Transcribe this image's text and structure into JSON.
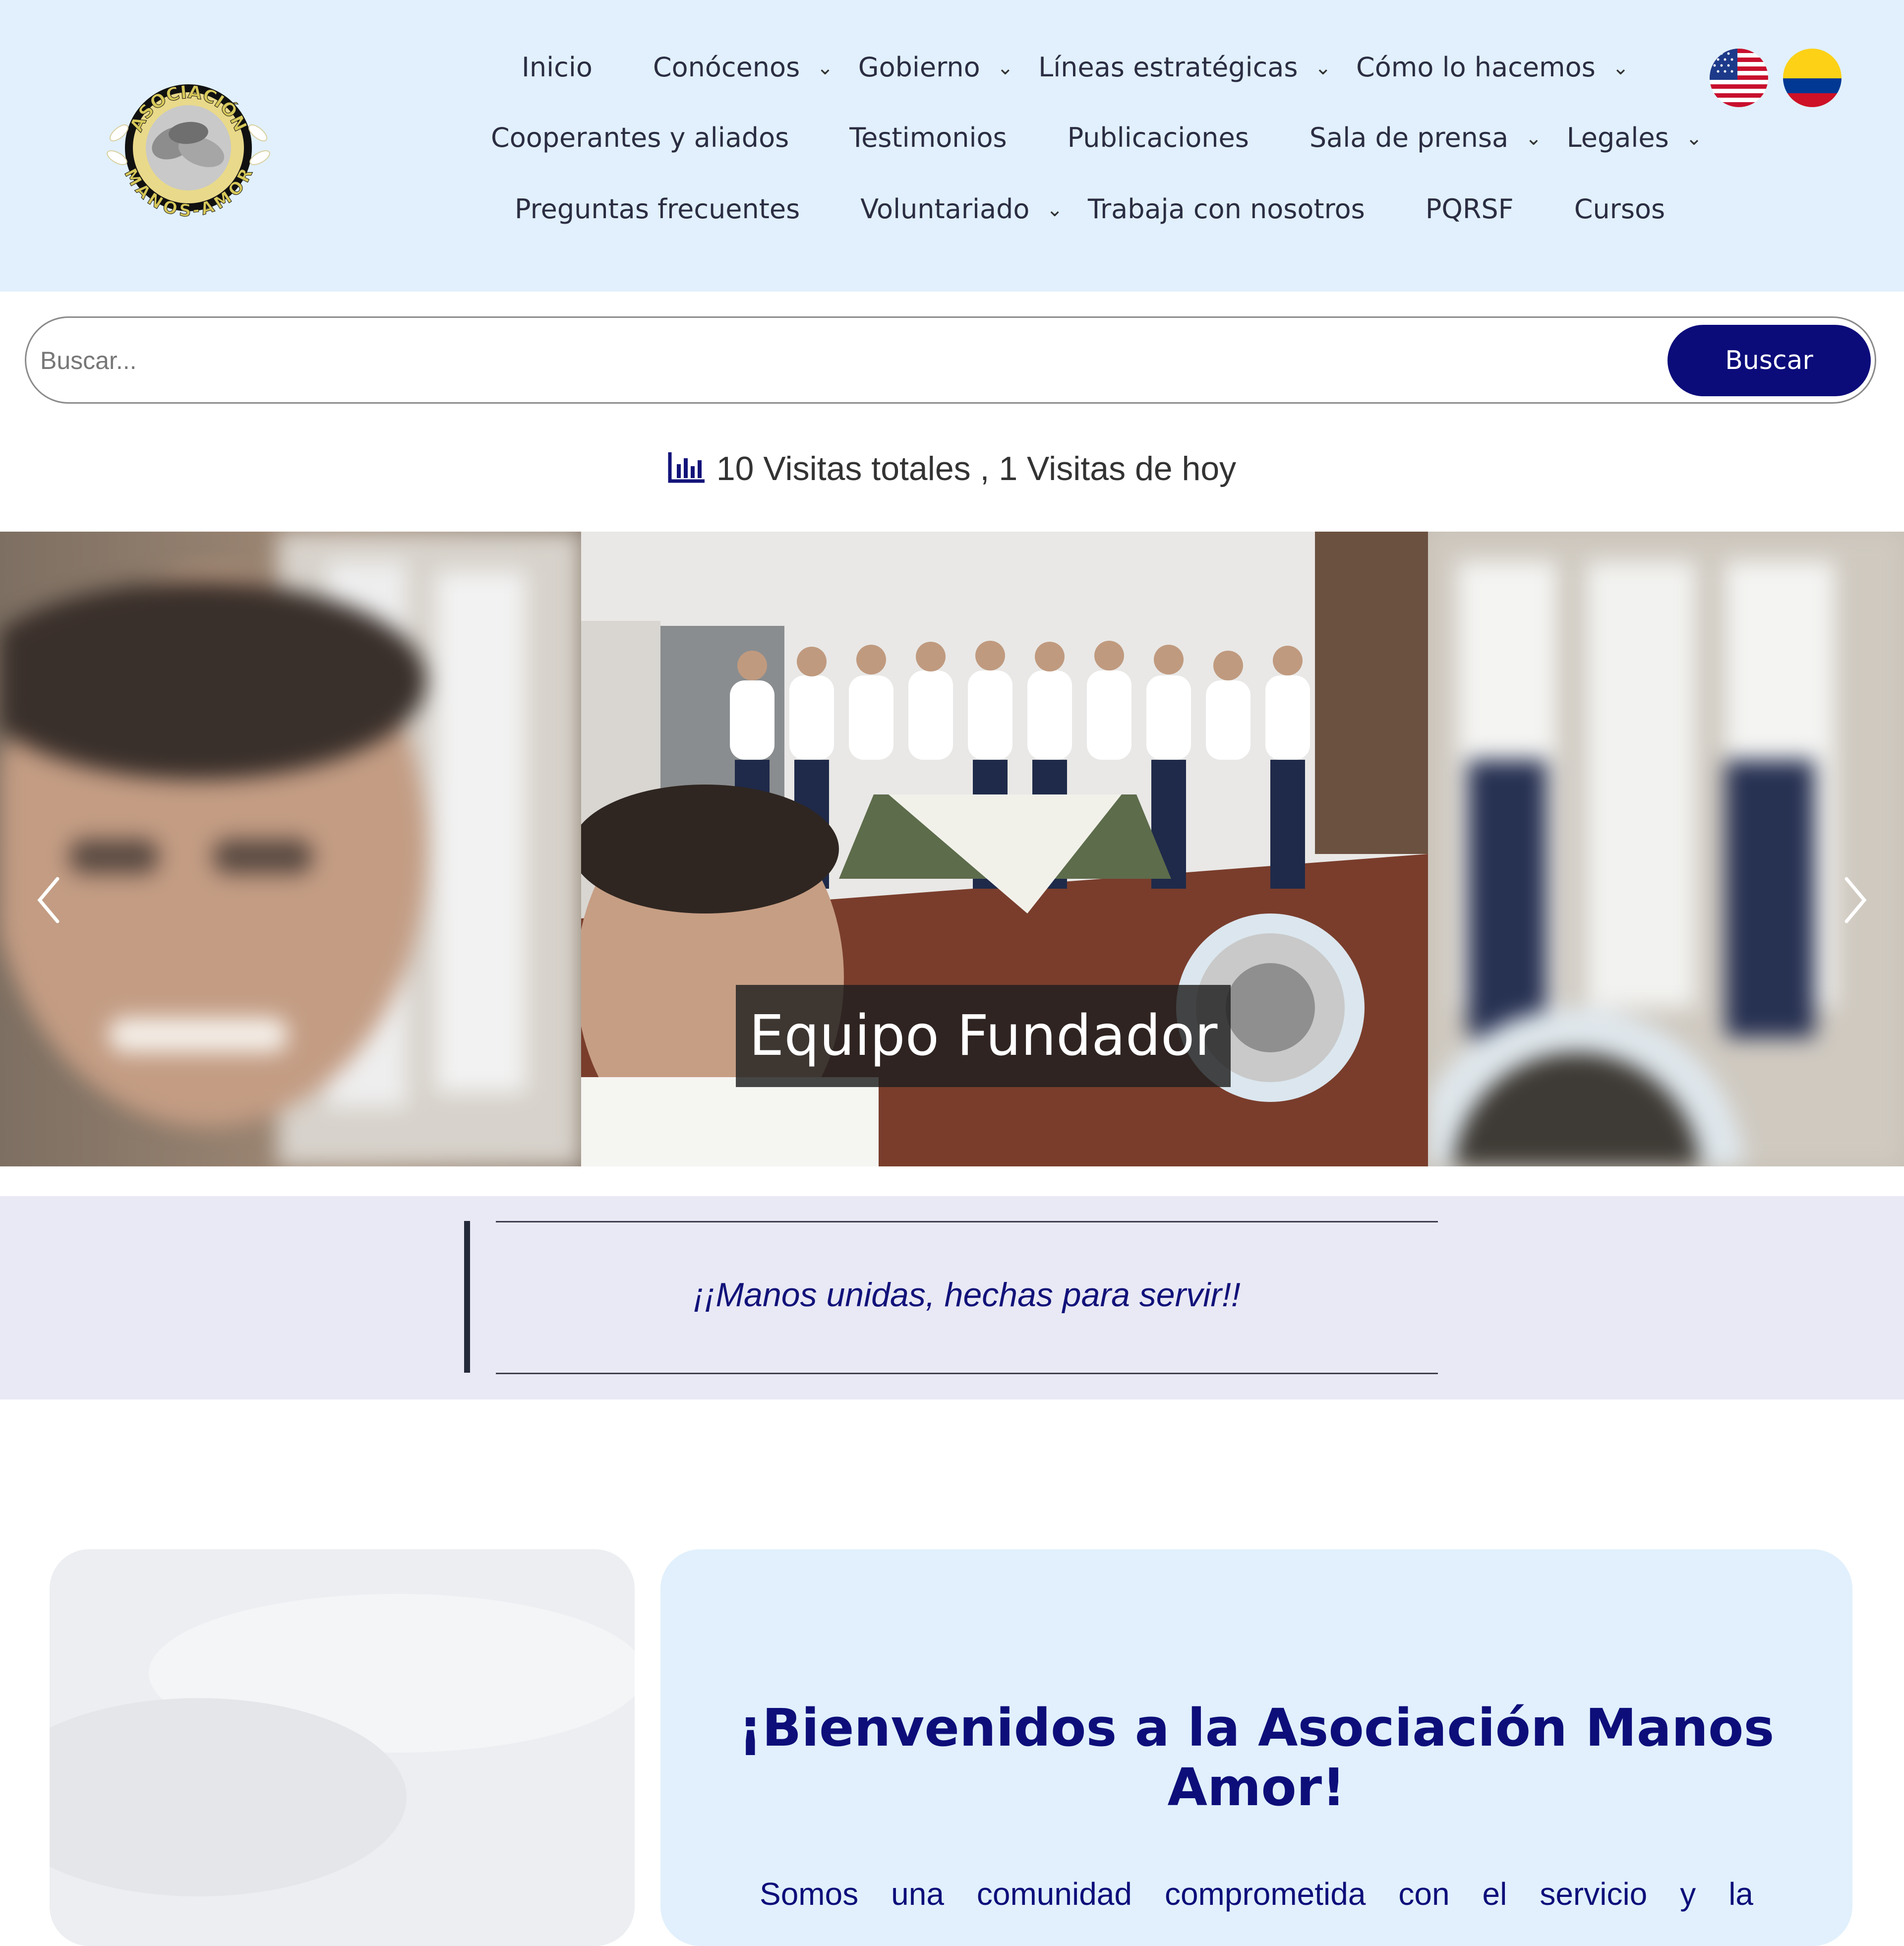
{
  "header": {
    "logo_text_top": "ASOCIACIÓN",
    "logo_text_bottom": "MANOS-AMOR",
    "nav": {
      "inicio": "Inicio",
      "conocenos": "Conócenos",
      "gobierno": "Gobierno",
      "lineas": "Líneas estratégicas",
      "como": "Cómo lo hacemos",
      "cooperantes": "Cooperantes y aliados",
      "testimonios": "Testimonios",
      "publicaciones": "Publicaciones",
      "prensa": "Sala de prensa",
      "legales": "Legales",
      "preguntas": "Preguntas frecuentes",
      "voluntariado": "Voluntariado",
      "trabaja": "Trabaja con nosotros",
      "pqrsf": "PQRSF",
      "cursos": "Cursos"
    },
    "chevron": "⌄",
    "languages": [
      "english-flag",
      "spanish-colombia-flag"
    ]
  },
  "search": {
    "placeholder": "Buscar...",
    "button_label": "Buscar"
  },
  "visits": {
    "text": "10 Visitas totales , 1 Visitas de hoy",
    "icon": "bar-chart-icon"
  },
  "carousel": {
    "caption": "Equipo Fundador",
    "prev_icon": "chevron-left-icon",
    "next_icon": "chevron-right-icon"
  },
  "motto": {
    "text": "¡¡Manos unidas, hechas para servir!!"
  },
  "welcome": {
    "title": "¡Bienvenidos a la Asociación Manos Amor!",
    "text": "Somos una comunidad comprometida con el servicio y la"
  },
  "colors": {
    "header_bg": "#e1f0fc",
    "primary": "#0b0b7a",
    "motto_bg": "#e9e9f5"
  }
}
